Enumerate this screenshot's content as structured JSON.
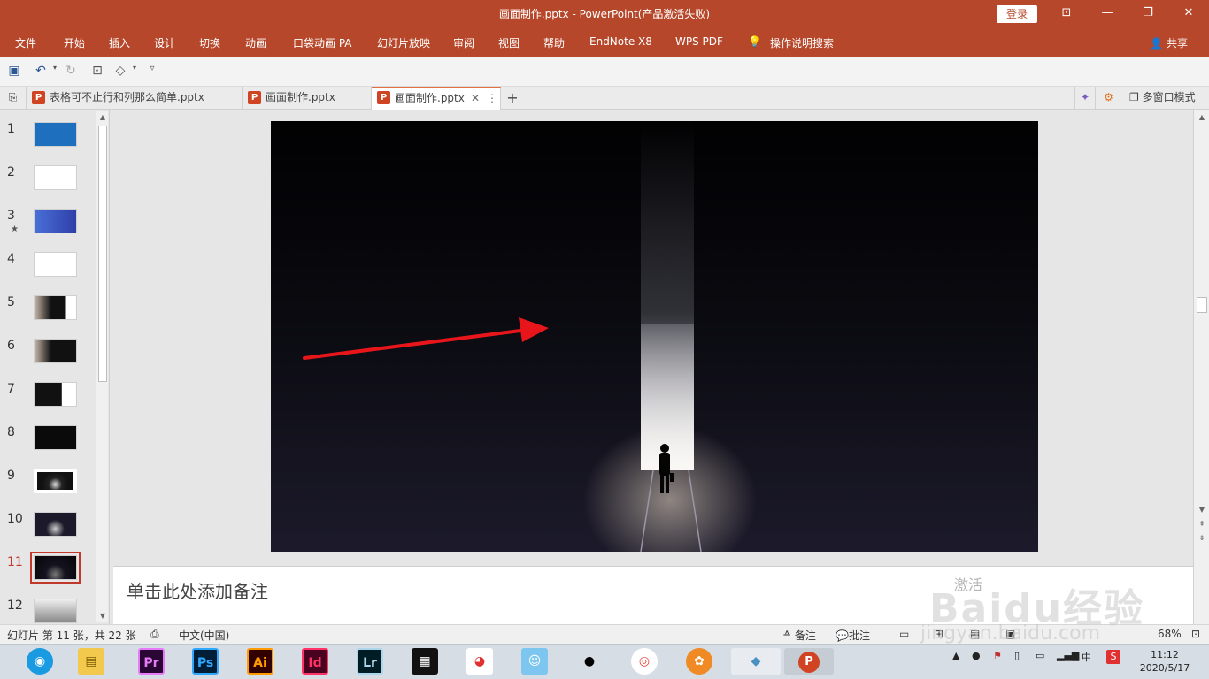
{
  "window": {
    "title": "画面制作.pptx  -  PowerPoint(产品激活失败)",
    "login_label": "登录",
    "minimize": "—",
    "maximize": "❐",
    "close": "✕",
    "restore_ribbon": "⊡"
  },
  "ribbon": {
    "tabs": [
      "文件",
      "开始",
      "插入",
      "设计",
      "切换",
      "动画",
      "口袋动画 PA",
      "幻灯片放映",
      "审阅",
      "视图",
      "帮助",
      "EndNote X8",
      "WPS PDF",
      "操作说明搜索"
    ],
    "share_label": "共享"
  },
  "doc_tabs": [
    {
      "label": "表格可不止行和列那么简单.pptx",
      "active": false
    },
    {
      "label": "画面制作.pptx",
      "active": false
    },
    {
      "label": "画面制作.pptx",
      "active": true
    }
  ],
  "doc_tabs_right": {
    "multi_window_label": "多窗口模式",
    "new_tab": "+"
  },
  "thumbnails": [
    {
      "num": "1",
      "star": false
    },
    {
      "num": "2",
      "star": false
    },
    {
      "num": "3",
      "star": true
    },
    {
      "num": "4",
      "star": false
    },
    {
      "num": "5",
      "star": false
    },
    {
      "num": "6",
      "star": false
    },
    {
      "num": "7",
      "star": false
    },
    {
      "num": "8",
      "star": false
    },
    {
      "num": "9",
      "star": false
    },
    {
      "num": "10",
      "star": false
    },
    {
      "num": "11",
      "star": false,
      "selected": true
    },
    {
      "num": "12",
      "star": false
    }
  ],
  "notes": {
    "placeholder": "单击此处添加备注"
  },
  "status": {
    "slide_info": "幻灯片 第 11 张，共 22 张",
    "language": "中文(中国)",
    "notes_label": "备注",
    "comments_label": "批注",
    "zoom": "68%"
  },
  "taskbar": {
    "apps": [
      {
        "name": "Pr",
        "color": "#e77bf7",
        "bg": "#2a0635"
      },
      {
        "name": "Ps",
        "color": "#31a8ff",
        "bg": "#001e36"
      },
      {
        "name": "Ai",
        "color": "#ff9a00",
        "bg": "#330000"
      },
      {
        "name": "Id",
        "color": "#ff3366",
        "bg": "#49021f"
      },
      {
        "name": "Lr",
        "color": "#add5ec",
        "bg": "#001d26"
      }
    ],
    "ime": "中",
    "time": "11:12",
    "date": "2020/5/17"
  },
  "watermark": {
    "activate_text": "激活",
    "brand": "Baidu经验",
    "url": "jingyan.baidu.com"
  },
  "colors": {
    "accent": "#b7472a",
    "selected_slide": "#c0392b",
    "arrow": "#e8161b"
  }
}
